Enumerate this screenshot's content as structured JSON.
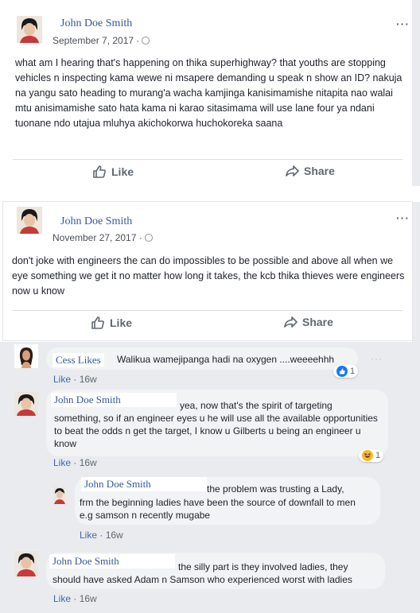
{
  "post1": {
    "author": "John Doe Smith",
    "date": "September 7, 2017 ·",
    "text": "what am I hearing that's happening on thika superhighway? that youths are stopping vehicles n inspecting kama wewe ni msapere demanding u speak n show an ID? nakuja na yangu sato heading to murang'a wacha kamjinga kanisimamishe nitapita nao walai mtu anisimamishe sato hata kama ni karao sitasimama will use lane four ya ndani tuonane ndo utajua mluhya akichokorwa huchokoreka saana",
    "like_label": "Like",
    "share_label": "Share",
    "more_icon": "more-options-icon"
  },
  "post2": {
    "author": "John Doe Smith",
    "date": "November 27, 2017 ·",
    "text": "don't joke with engineers the can do impossibles to be possible and above all when we eye something we get it no matter how long it takes, the kcb thika thieves were engineers now u know",
    "like_label": "Like",
    "share_label": "Share"
  },
  "comments": [
    {
      "author": "Cess Likes",
      "text": "Walikua wamejipanga hadi na oxygen ....weeeehhh",
      "like": "Like",
      "age": "· 16w",
      "reaction_count": "1",
      "reaction": "like"
    },
    {
      "author": "John Doe Smith",
      "text_line1": "yea, now that's the spirit of targeting",
      "text_rest": "something, so if an engineer eyes u he will use all the available opportunities to beat the odds n get the target, I know u Gilberts u being an engineer u know",
      "like": "Like",
      "age": "· 16w",
      "reaction_count": "1",
      "reaction": "haha"
    },
    {
      "author": "John Doe Smith",
      "text_line1": "the problem was trusting a Lady,",
      "text_rest": "frm the beginning ladies have been the source of downfall to men e.g samson n recently mugabe",
      "like": "Like",
      "age": "· 16w"
    },
    {
      "author": "John Doe Smith",
      "text_line1": "the silly part is they involved ladies, they",
      "text_rest": "should have asked Adam n Samson who experienced worst with ladies",
      "like": "Like",
      "age": "· 16w"
    }
  ],
  "colors": {
    "link": "#365899",
    "bg_gray": "#e9ebee",
    "bubble": "#f2f3f5"
  }
}
